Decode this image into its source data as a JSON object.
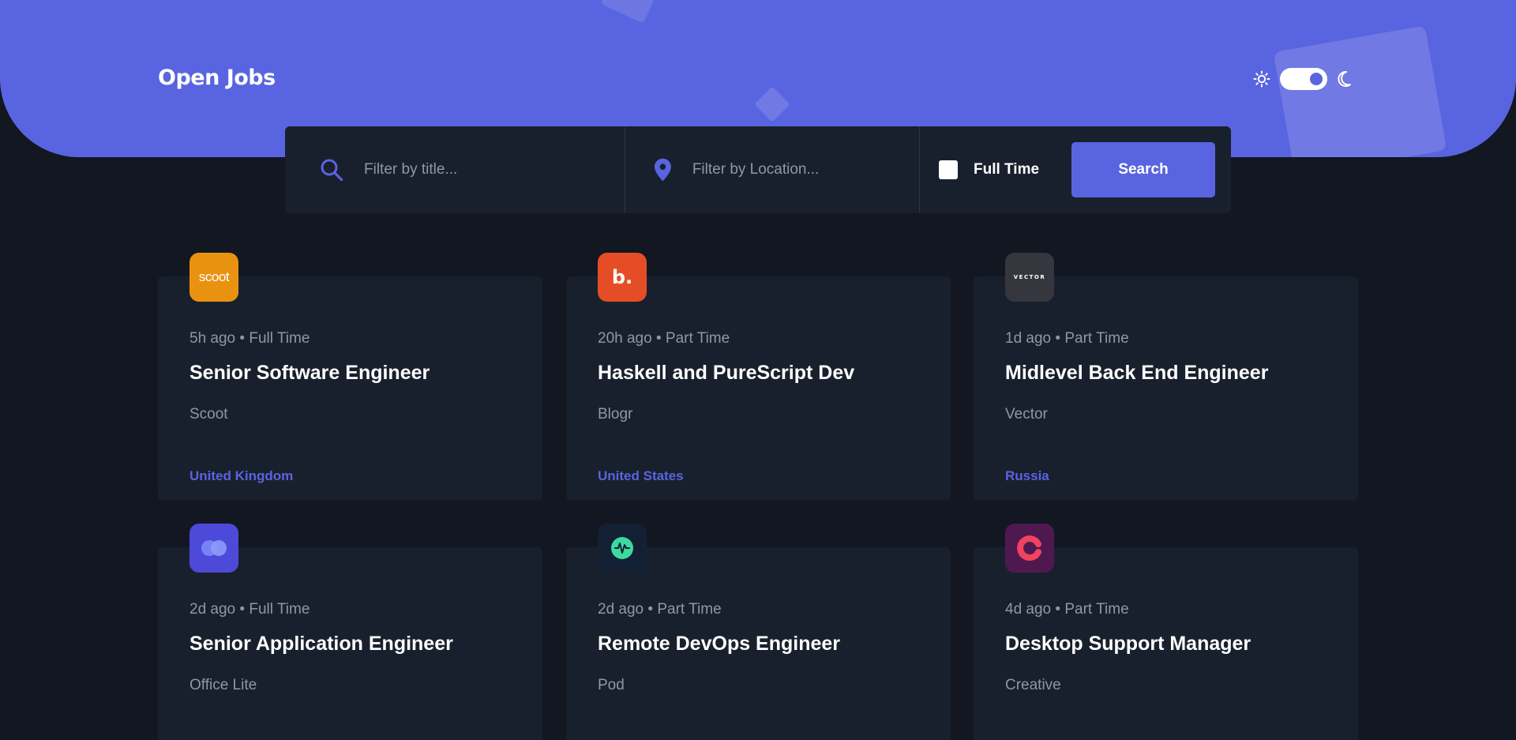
{
  "header": {
    "brand": "Open Jobs",
    "accent_color": "#5964E0",
    "theme_toggle": {
      "light_icon": "sun-icon",
      "dark_icon": "moon-icon",
      "state": "dark"
    }
  },
  "filter": {
    "title_placeholder": "Filter by title...",
    "title_icon": "search-icon",
    "location_placeholder": "Filter by Location...",
    "location_icon": "location-pin-icon",
    "full_time_label": "Full Time",
    "full_time_checked": false,
    "search_label": "Search"
  },
  "jobs": [
    {
      "posted": "5h ago",
      "separator": "•",
      "contract": "Full Time",
      "title": "Senior Software Engineer",
      "company": "Scoot",
      "location": "United Kingdom",
      "logo_text": "scoot",
      "logo_color": "#E99210"
    },
    {
      "posted": "20h ago",
      "separator": "•",
      "contract": "Part Time",
      "title": "Haskell and PureScript Dev",
      "company": "Blogr",
      "location": "United States",
      "logo_text": "b.",
      "logo_color": "#E54D26"
    },
    {
      "posted": "1d ago",
      "separator": "•",
      "contract": "Part Time",
      "title": "Midlevel Back End Engineer",
      "company": "Vector",
      "location": "Russia",
      "logo_text": "VECTOR",
      "logo_color": "#36363E"
    },
    {
      "posted": "2d ago",
      "separator": "•",
      "contract": "Full Time",
      "title": "Senior Application Engineer",
      "company": "Office Lite",
      "logo_color": "#4E4AD9"
    },
    {
      "posted": "2d ago",
      "separator": "•",
      "contract": "Part Time",
      "title": "Remote DevOps Engineer",
      "company": "Pod",
      "logo_color": "#132034"
    },
    {
      "posted": "4d ago",
      "separator": "•",
      "contract": "Part Time",
      "title": "Desktop Support Manager",
      "company": "Creative",
      "logo_color": "#4F1950"
    }
  ]
}
